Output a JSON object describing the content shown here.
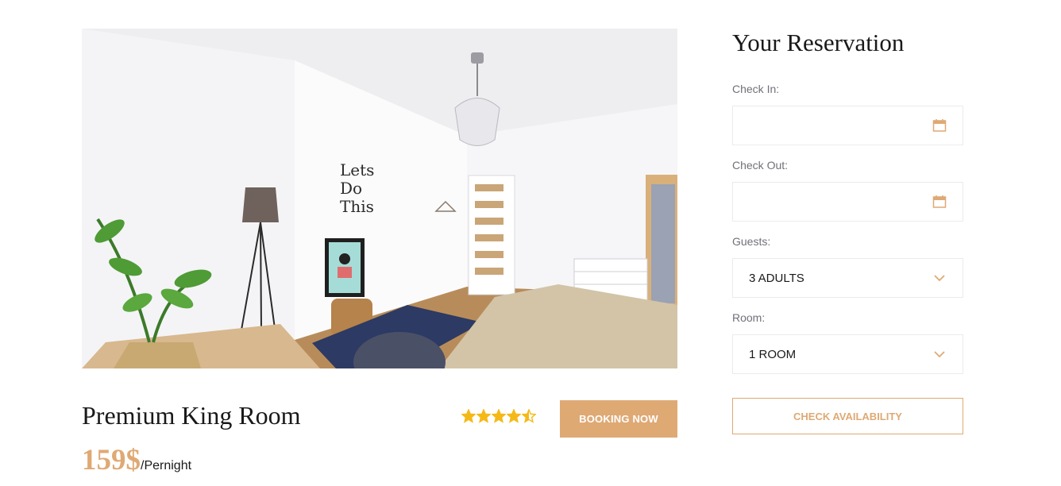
{
  "room": {
    "title": "Premium King Room",
    "price": "159$",
    "price_unit": "/Pernight",
    "rating": 4.5,
    "booking_label": "BOOKING NOW"
  },
  "reservation": {
    "title": "Your Reservation",
    "check_in_label": "Check In:",
    "check_in_value": "",
    "check_out_label": "Check Out:",
    "check_out_value": "",
    "guests_label": "Guests:",
    "guests_value": "3 ADULTS",
    "room_label": "Room:",
    "room_value": "1 ROOM",
    "check_label": "CHECK AVAILABILITY"
  },
  "colors": {
    "accent": "#dfa974",
    "star": "#f5b917",
    "text": "#19191a",
    "muted": "#707079",
    "border": "#ebebeb"
  },
  "icons": {
    "calendar": "calendar-icon",
    "dropdown": "chevron-down-icon",
    "star": "star-icon"
  }
}
